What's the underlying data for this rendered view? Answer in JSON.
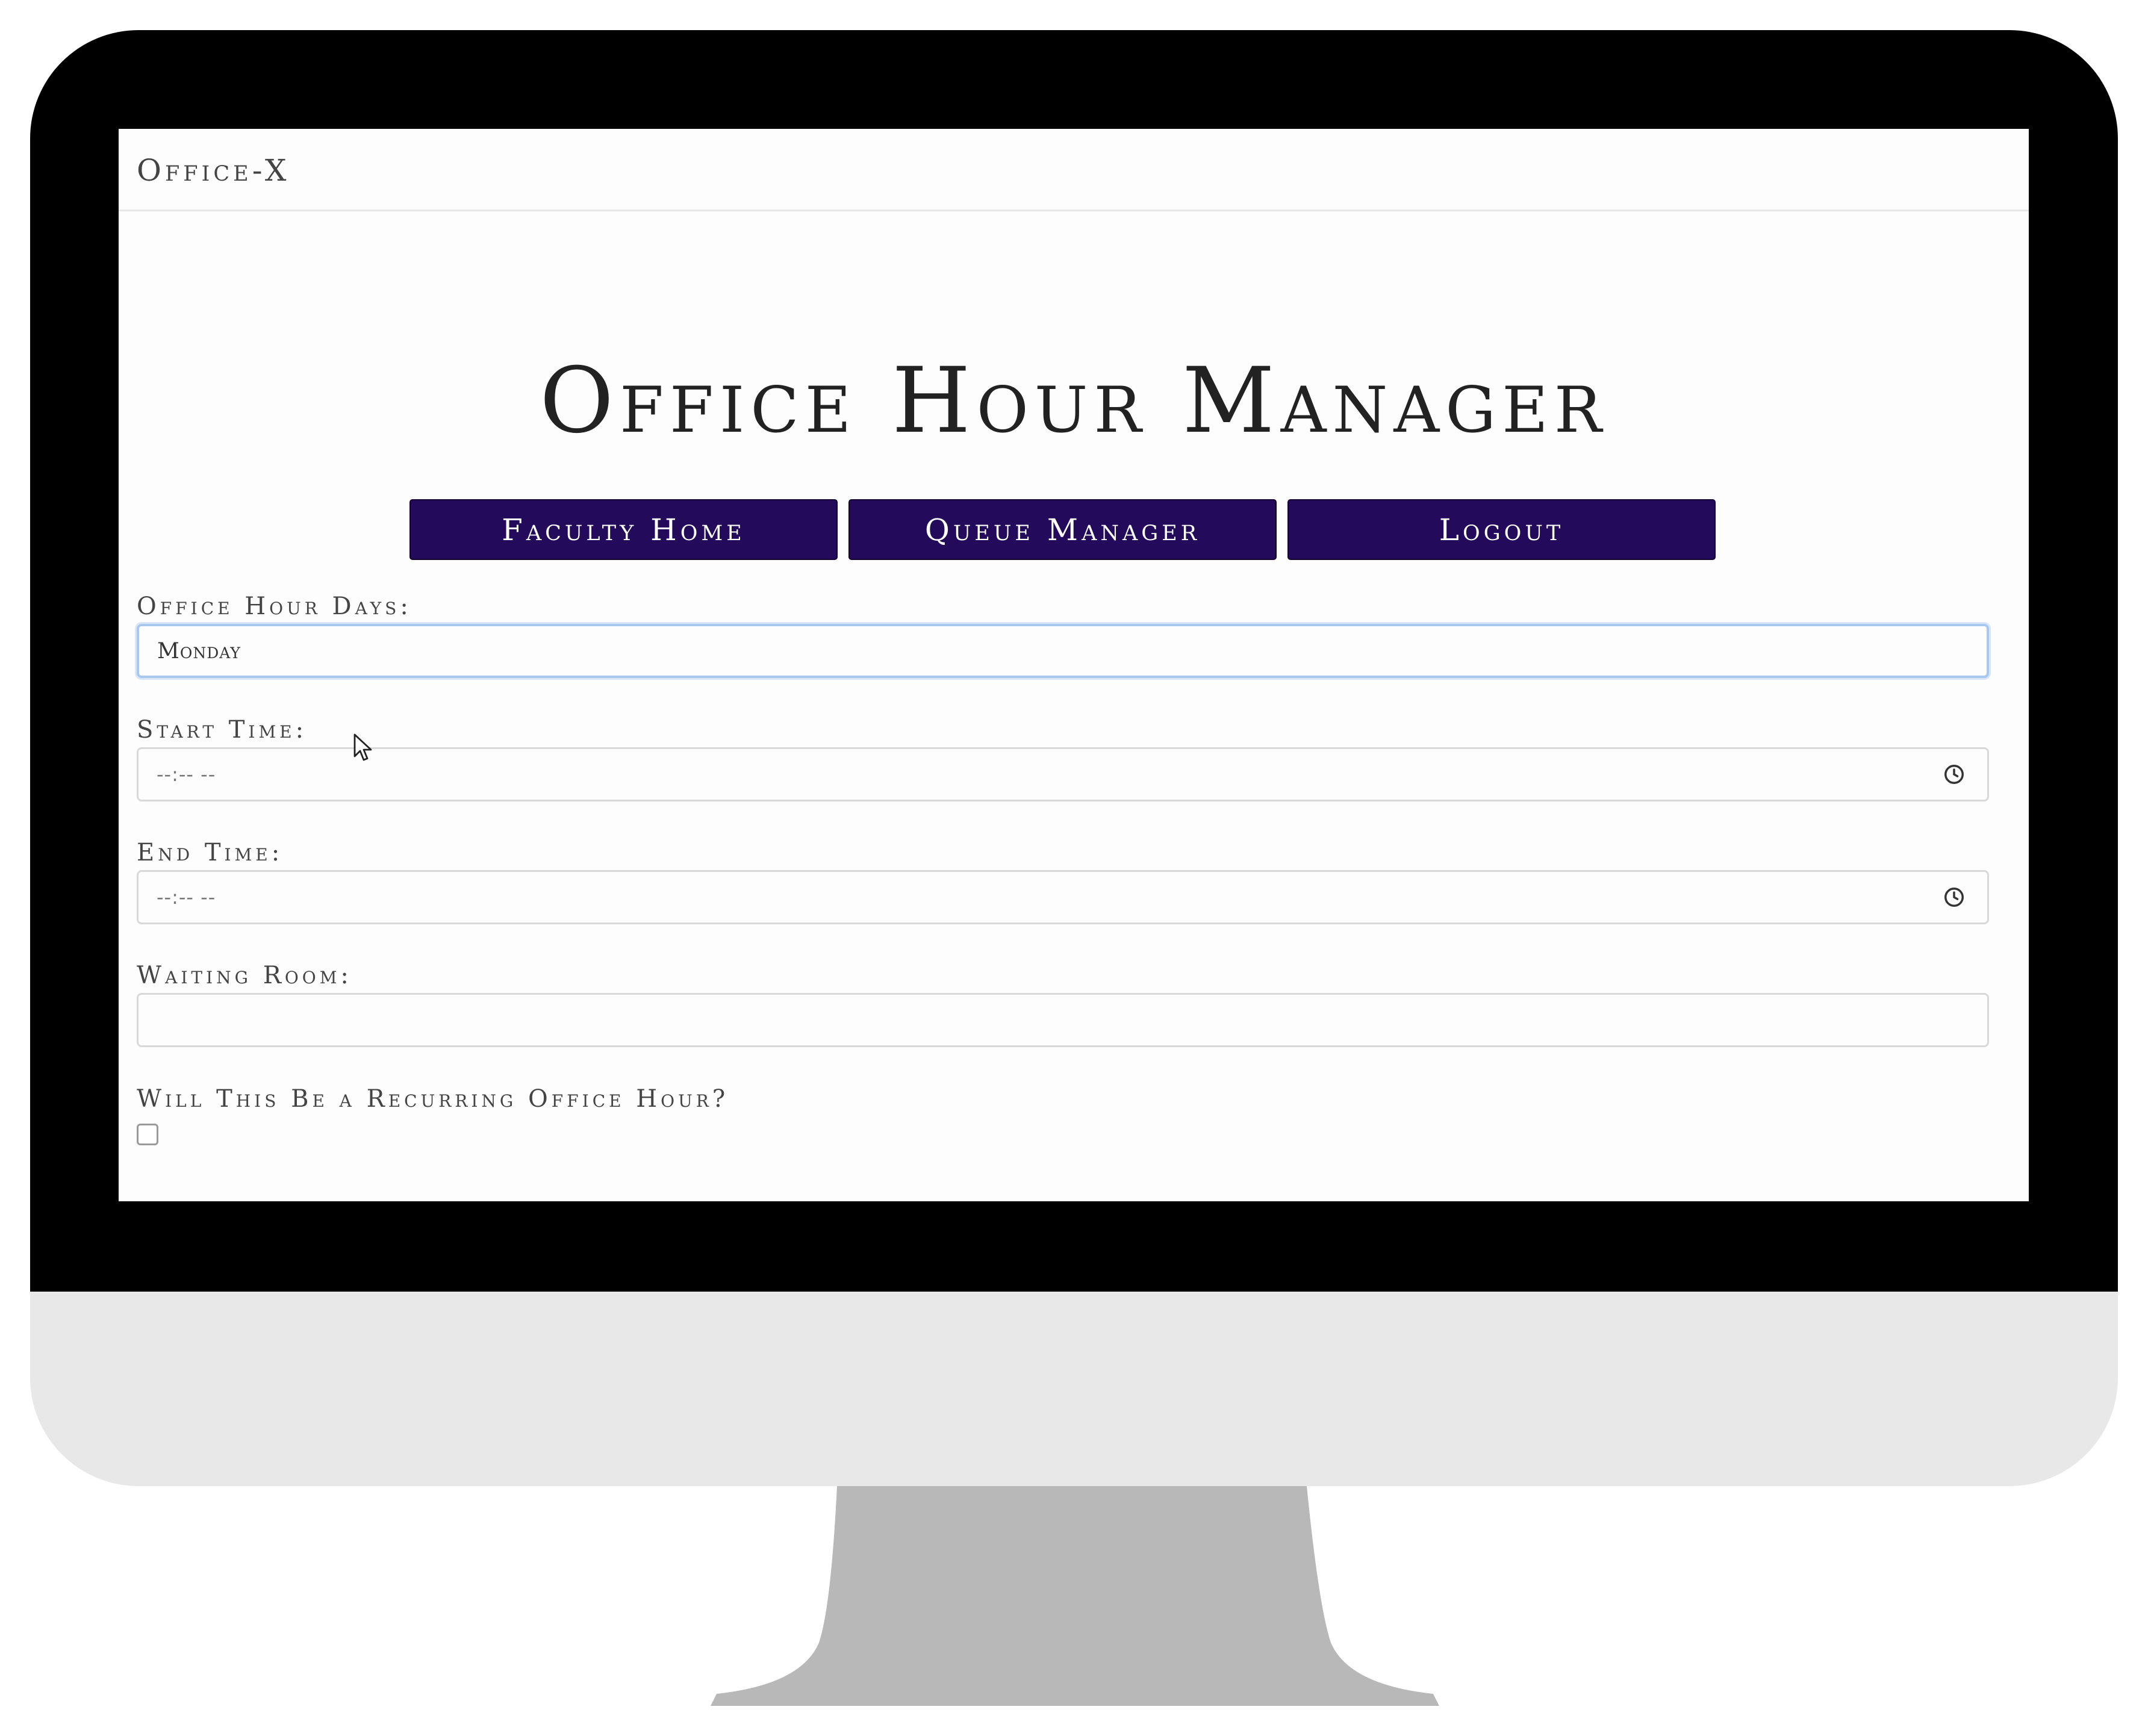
{
  "navbar": {
    "brand": "Office-X"
  },
  "header": {
    "title": "Office Hour Manager"
  },
  "nav_buttons": [
    {
      "label": "Faculty Home"
    },
    {
      "label": "Queue Manager"
    },
    {
      "label": "Logout"
    }
  ],
  "form": {
    "office_hour_days": {
      "label": "Office Hour Days:",
      "value": "Monday"
    },
    "start_time": {
      "label": "Start Time:",
      "placeholder": "--:-- --"
    },
    "end_time": {
      "label": "End Time:",
      "placeholder": "--:-- --"
    },
    "waiting_room": {
      "label": "Waiting Room:",
      "value": ""
    },
    "recurring": {
      "label": "Will This Be a Recurring Office Hour?",
      "checked": false
    }
  },
  "colors": {
    "button_bg": "#230a5a",
    "button_text": "#ffffff",
    "focus_border": "#a9c8ee",
    "monitor_bezel": "#000000",
    "monitor_chin": "#e8e8e8",
    "monitor_stand": "#b8b8b8"
  },
  "icons": {
    "time_input": "clock-icon",
    "pointer": "mouse-cursor-icon"
  }
}
